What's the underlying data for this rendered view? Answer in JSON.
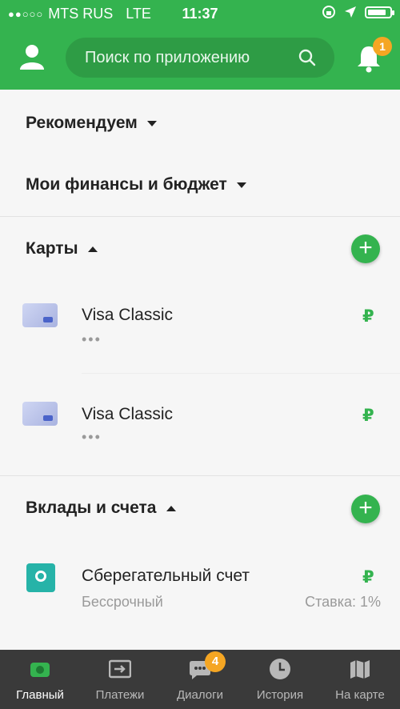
{
  "status_bar": {
    "signal": "●●○○○",
    "carrier": "MTS RUS",
    "network": "LTE",
    "time": "11:37",
    "battery_level": 0.85
  },
  "header": {
    "search_placeholder": "Поиск по приложению",
    "notifications_count": "1",
    "accent_color": "#34b34f"
  },
  "sections": {
    "recommend": {
      "title": "Рекомендуем"
    },
    "finance": {
      "title": "Мои финансы и бюджет"
    },
    "cards": {
      "title": "Карты",
      "items": [
        {
          "name": "Visa Classic",
          "masked": "•••",
          "currency": "₽"
        },
        {
          "name": "Visa Classic",
          "masked": "•••",
          "currency": "₽"
        }
      ]
    },
    "deposits": {
      "title": "Вклады и счета",
      "items": [
        {
          "name": "Сберегательный счет",
          "term": "Бессрочный",
          "rate": "Ставка: 1%",
          "currency": "₽"
        }
      ]
    }
  },
  "bottom_nav": {
    "items": [
      {
        "label": "Главный",
        "icon": "home-icon",
        "active": true
      },
      {
        "label": "Платежи",
        "icon": "payments-icon"
      },
      {
        "label": "Диалоги",
        "icon": "chat-icon",
        "badge": "4"
      },
      {
        "label": "История",
        "icon": "clock-icon"
      },
      {
        "label": "На карте",
        "icon": "map-icon"
      }
    ]
  }
}
